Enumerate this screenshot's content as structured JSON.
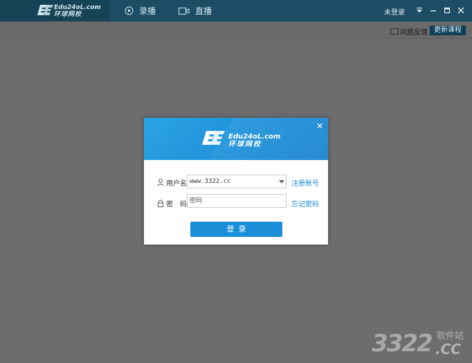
{
  "titlebar": {
    "logo_text_en": "Edu24oL.com",
    "logo_text_cn": "环球网校",
    "tab_record": "录播",
    "tab_live": "直播",
    "login_status": "未登录"
  },
  "toolbar": {
    "feedback_label": "问题反馈",
    "update_label": "更新课程"
  },
  "dialog": {
    "logo_text_en": "Edu24oL.com",
    "logo_text_cn": "环球网校",
    "close_label": "✕",
    "username_label": "用户名",
    "username_value": "www.3322.cc",
    "password_label": "密　码",
    "password_placeholder": "密码",
    "register_link": "注册账号",
    "forgot_link": "忘记密码",
    "login_button": "登录"
  },
  "watermark": {
    "number": "3322",
    "site": "软件站",
    "domain": ".CC"
  },
  "colors": {
    "titlebar_bg": "#1c4d64",
    "accent_blue": "#1a8fd8",
    "overlay": "#6d6d6d"
  }
}
